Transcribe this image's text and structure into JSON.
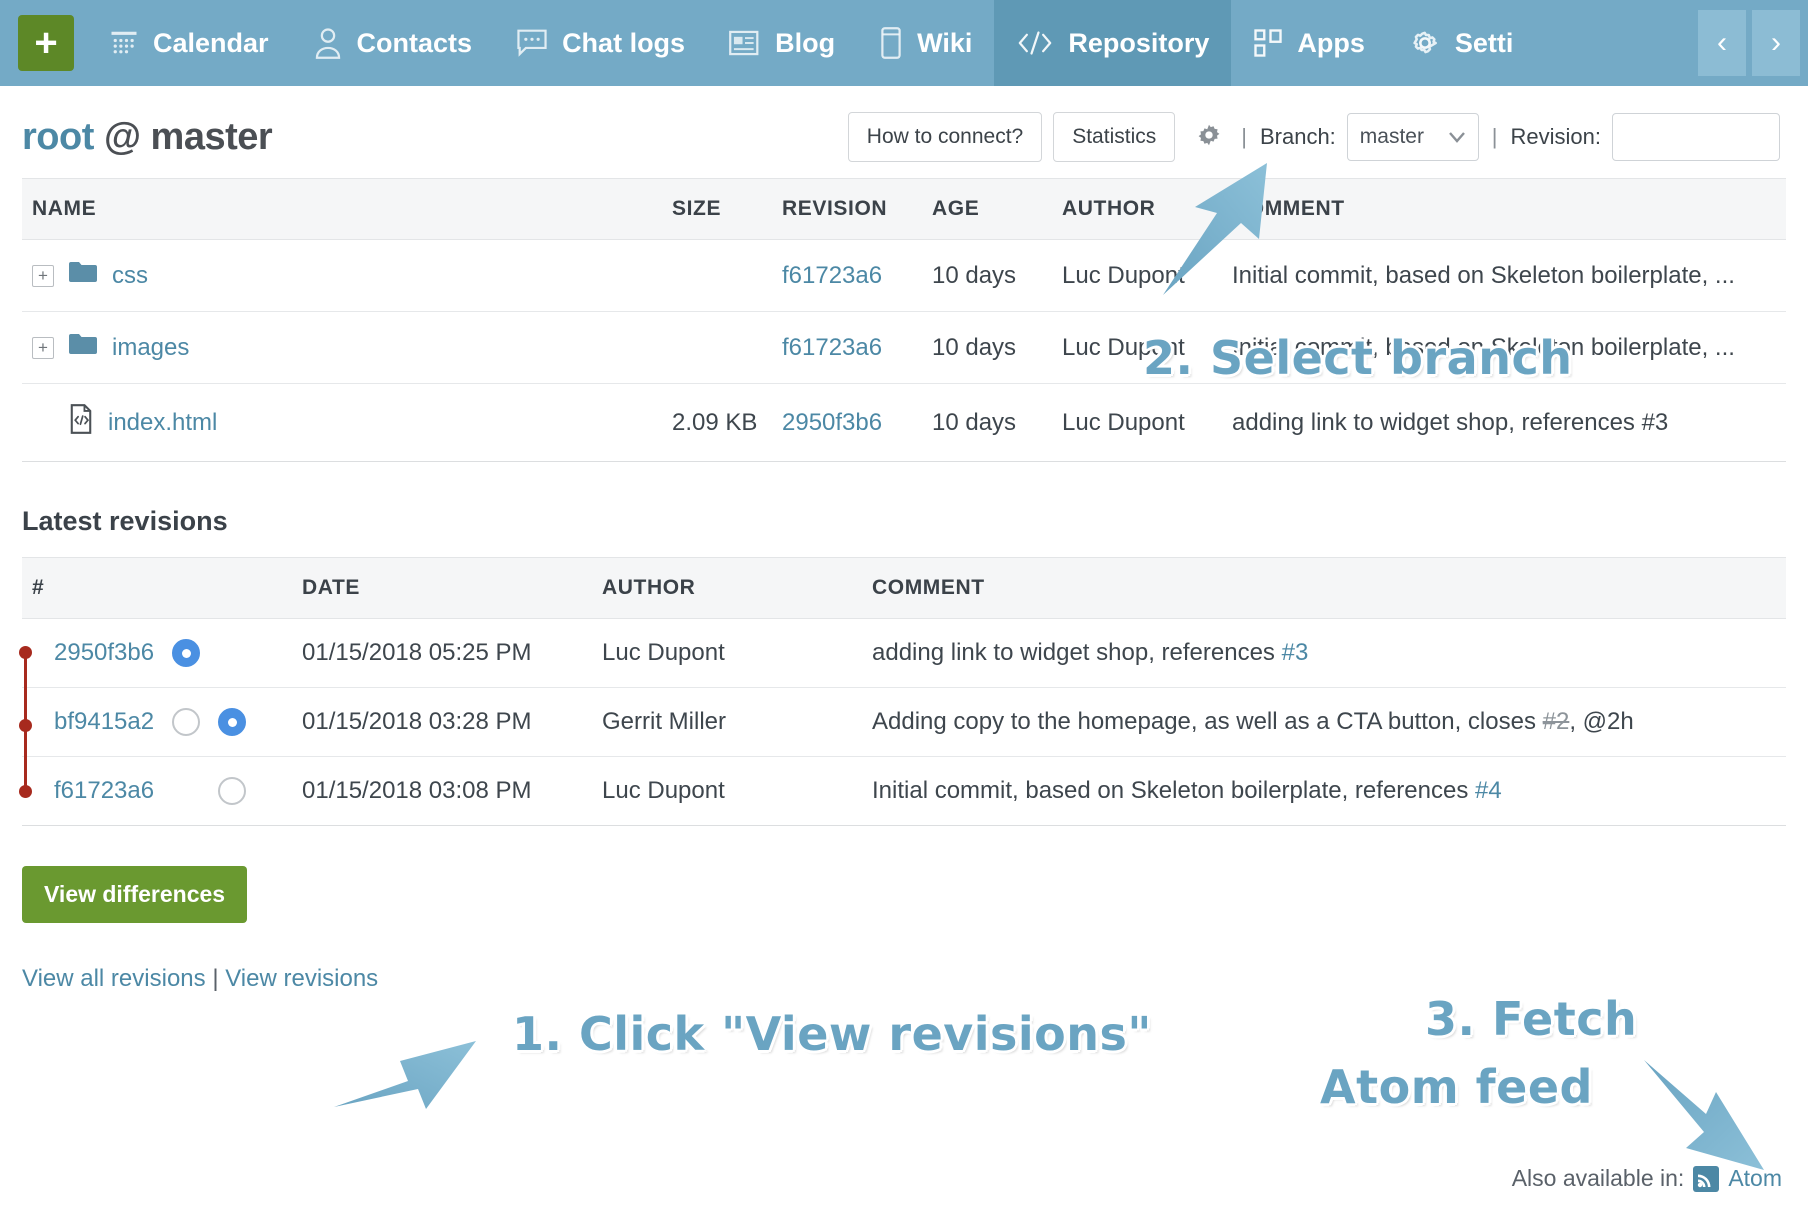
{
  "nav": {
    "add_label": "+",
    "items": [
      {
        "label": "Calendar",
        "icon": "calendar-icon",
        "active": false
      },
      {
        "label": "Contacts",
        "icon": "contacts-icon",
        "active": false
      },
      {
        "label": "Chat logs",
        "icon": "chat-icon",
        "active": false
      },
      {
        "label": "Blog",
        "icon": "blog-icon",
        "active": false
      },
      {
        "label": "Wiki",
        "icon": "wiki-icon",
        "active": false
      },
      {
        "label": "Repository",
        "icon": "code-icon",
        "active": true
      },
      {
        "label": "Apps",
        "icon": "apps-icon",
        "active": false
      },
      {
        "label": "Setti",
        "icon": "gear-icon",
        "active": false
      }
    ],
    "prev_label": "‹",
    "next_label": "›"
  },
  "header": {
    "title_root": "root",
    "title_rest": "@ master",
    "how_to_connect": "How to connect?",
    "statistics": "Statistics",
    "settings_icon": "gear-icon",
    "branch_sep": "|",
    "branch_label": "Branch:",
    "branch_value": "master",
    "revision_sep": "|",
    "revision_label": "Revision:",
    "revision_value": ""
  },
  "files_table": {
    "columns": [
      "NAME",
      "SIZE",
      "REVISION",
      "AGE",
      "AUTHOR",
      "COMMENT"
    ],
    "rows": [
      {
        "expandable": true,
        "icon": "folder-icon",
        "name": "css",
        "size": "",
        "revision": "f61723a6",
        "age": "10 days",
        "author": "Luc Dupont",
        "comment": "Initial commit, based on Skeleton boilerplate, ..."
      },
      {
        "expandable": true,
        "icon": "folder-icon",
        "name": "images",
        "size": "",
        "revision": "f61723a6",
        "age": "10 days",
        "author": "Luc Dupont",
        "comment": "Initial commit, based on Skeleton boilerplate, ..."
      },
      {
        "expandable": false,
        "icon": "file-code-icon",
        "name": "index.html",
        "size": "2.09 KB",
        "revision": "2950f3b6",
        "age": "10 days",
        "author": "Luc Dupont",
        "comment": "adding link to widget shop, references #3"
      }
    ]
  },
  "revisions": {
    "heading": "Latest revisions",
    "columns": [
      "#",
      "DATE",
      "AUTHOR",
      "COMMENT"
    ],
    "rows": [
      {
        "id": "2950f3b6",
        "radio_a": "selected",
        "radio_b": "none",
        "date": "01/15/2018 05:25 PM",
        "author": "Luc Dupont",
        "comment_text": "adding link to widget shop, references ",
        "comment_link": "#3",
        "comment_strike": "",
        "comment_tail": ""
      },
      {
        "id": "bf9415a2",
        "radio_a": "empty",
        "radio_b": "selected",
        "date": "01/15/2018 03:28 PM",
        "author": "Gerrit Miller",
        "comment_text": "Adding copy to the homepage, as well as a CTA button, closes ",
        "comment_link": "",
        "comment_strike": "#2",
        "comment_tail": ", @2h"
      },
      {
        "id": "f61723a6",
        "radio_a": "empty",
        "radio_b": "none",
        "date": "01/15/2018 03:08 PM",
        "author": "Luc Dupont",
        "comment_text": "Initial commit, based on Skeleton boilerplate, references ",
        "comment_link": "#4",
        "comment_strike": "",
        "comment_tail": ""
      }
    ]
  },
  "footer": {
    "view_differences": "View differences",
    "view_all_revisions": "View all revisions",
    "links_separator": "|",
    "view_revisions": "View revisions",
    "also_available": "Also available in:",
    "atom_label": "Atom",
    "atom_icon": "rss-icon"
  },
  "annotations": [
    {
      "name": "annotation-select-branch",
      "text": "2. Select branch"
    },
    {
      "name": "annotation-click-view-revisions",
      "text": "1. Click \"View revisions\""
    },
    {
      "name": "annotation-fetch-atom-feed-line1",
      "text": "3. Fetch"
    },
    {
      "name": "annotation-fetch-atom-feed-line2",
      "text": "Atom feed"
    }
  ],
  "colors": {
    "nav_bg": "#74aac6",
    "nav_active": "#5f99b5",
    "link": "#4c88a5",
    "green_button": "#6a9930",
    "add_button": "#5d8827",
    "annotation": "#6aa4c2",
    "graph_red": "#a72a1e",
    "radio_selected": "#4a90e2"
  }
}
